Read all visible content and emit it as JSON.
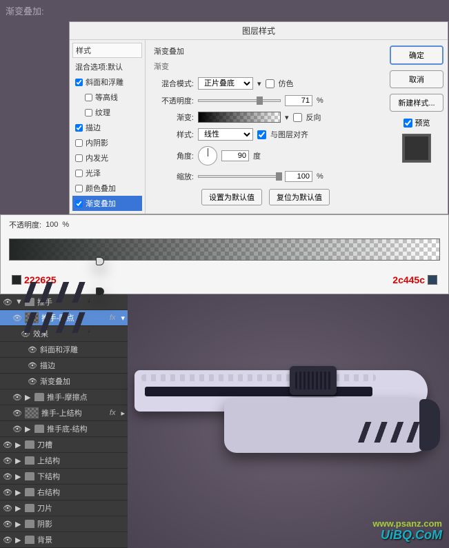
{
  "top_label": "渐变叠加:",
  "dialog": {
    "title": "图层样式",
    "styles_header": "样式",
    "blend_options": "混合选项:默认",
    "style_items": [
      {
        "label": "斜面和浮雕",
        "checked": true
      },
      {
        "label": "等高线",
        "checked": false
      },
      {
        "label": "纹理",
        "checked": false
      },
      {
        "label": "描边",
        "checked": true
      },
      {
        "label": "内阴影",
        "checked": false
      },
      {
        "label": "内发光",
        "checked": false
      },
      {
        "label": "光泽",
        "checked": false
      },
      {
        "label": "颜色叠加",
        "checked": false
      },
      {
        "label": "渐变叠加",
        "checked": true,
        "selected": true
      }
    ],
    "section_title": "渐变叠加",
    "sub_title": "渐变",
    "blend_mode_label": "混合模式:",
    "blend_mode_value": "正片叠底",
    "dither_label": "仿色",
    "opacity_label": "不透明度:",
    "opacity_value": "71",
    "percent": "%",
    "gradient_label": "渐变:",
    "reverse_label": "反向",
    "style_label": "样式:",
    "style_value": "线性",
    "align_label": "与图层对齐",
    "angle_label": "角度:",
    "angle_value": "90",
    "degree": "度",
    "scale_label": "缩放:",
    "scale_value": "100",
    "set_default": "设置为默认值",
    "reset_default": "复位为默认值",
    "ok": "确定",
    "cancel": "取消",
    "new_style": "新建样式...",
    "preview": "预览"
  },
  "gradient_editor": {
    "opacity_label": "不透明度:",
    "value_display": "100",
    "left_color": "222625",
    "right_color": "2c445c"
  },
  "layers": {
    "group_pushhand": "推手",
    "layer_circle": "推手-圆点",
    "fx": "fx",
    "effects": "效果",
    "effect_bevel": "斜面和浮雕",
    "effect_stroke": "描边",
    "effect_gradient": "渐变叠加",
    "layer_friction": "推手-摩擦点",
    "layer_upper": "推手-上结构",
    "layer_bottom": "推手底-结构",
    "group_slot": "刀槽",
    "group_upper": "上结构",
    "group_lower": "下结构",
    "group_right": "右结构",
    "group_blade": "刀片",
    "group_shadow": "阴影",
    "group_bg": "背景"
  },
  "watermark": "UiBQ.CoM",
  "watermark2": "www.psanz.com"
}
